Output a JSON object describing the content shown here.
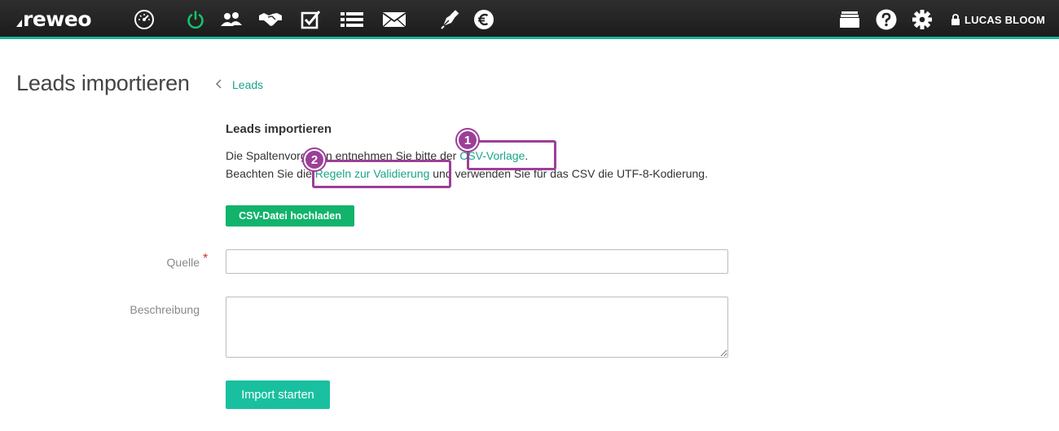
{
  "app": {
    "logo_text": "reweo"
  },
  "topbar": {
    "icons": [
      "dashboard-gauge-icon",
      "power-icon",
      "contacts-icon",
      "handshake-icon",
      "tasks-checkbox-icon",
      "list-icon",
      "mail-icon",
      "pen-nib-icon",
      "euro-icon"
    ],
    "right_icons": [
      "archive-box-icon",
      "help-icon",
      "settings-gear-icon",
      "lock-icon"
    ],
    "user_name": "LUCAS BLOOM",
    "accent_color": "#19b394"
  },
  "header": {
    "title": "Leads importieren",
    "breadcrumb_link": "Leads"
  },
  "form": {
    "section_title": "Leads importieren",
    "desc_line1_prefix": "Die Spaltenvorgaben entnehmen Sie bitte der ",
    "desc_line1_link": "CSV-Vorlage",
    "desc_line1_suffix": ".",
    "desc_line2_prefix": "Beachten Sie die ",
    "desc_line2_link": "Regeln zur Validierung",
    "desc_line2_suffix": " und verwenden Sie für das CSV die UTF-8-Kodierung.",
    "upload_label": "CSV-Datei hochladen",
    "quelle_label": "Quelle",
    "required_mark": "*",
    "quelle_value": "",
    "beschreibung_label": "Beschreibung",
    "beschreibung_value": "",
    "submit_label": "Import starten"
  },
  "annotations": [
    {
      "number": "1",
      "color": "#9c3f98"
    },
    {
      "number": "2",
      "color": "#9c3f98"
    }
  ]
}
